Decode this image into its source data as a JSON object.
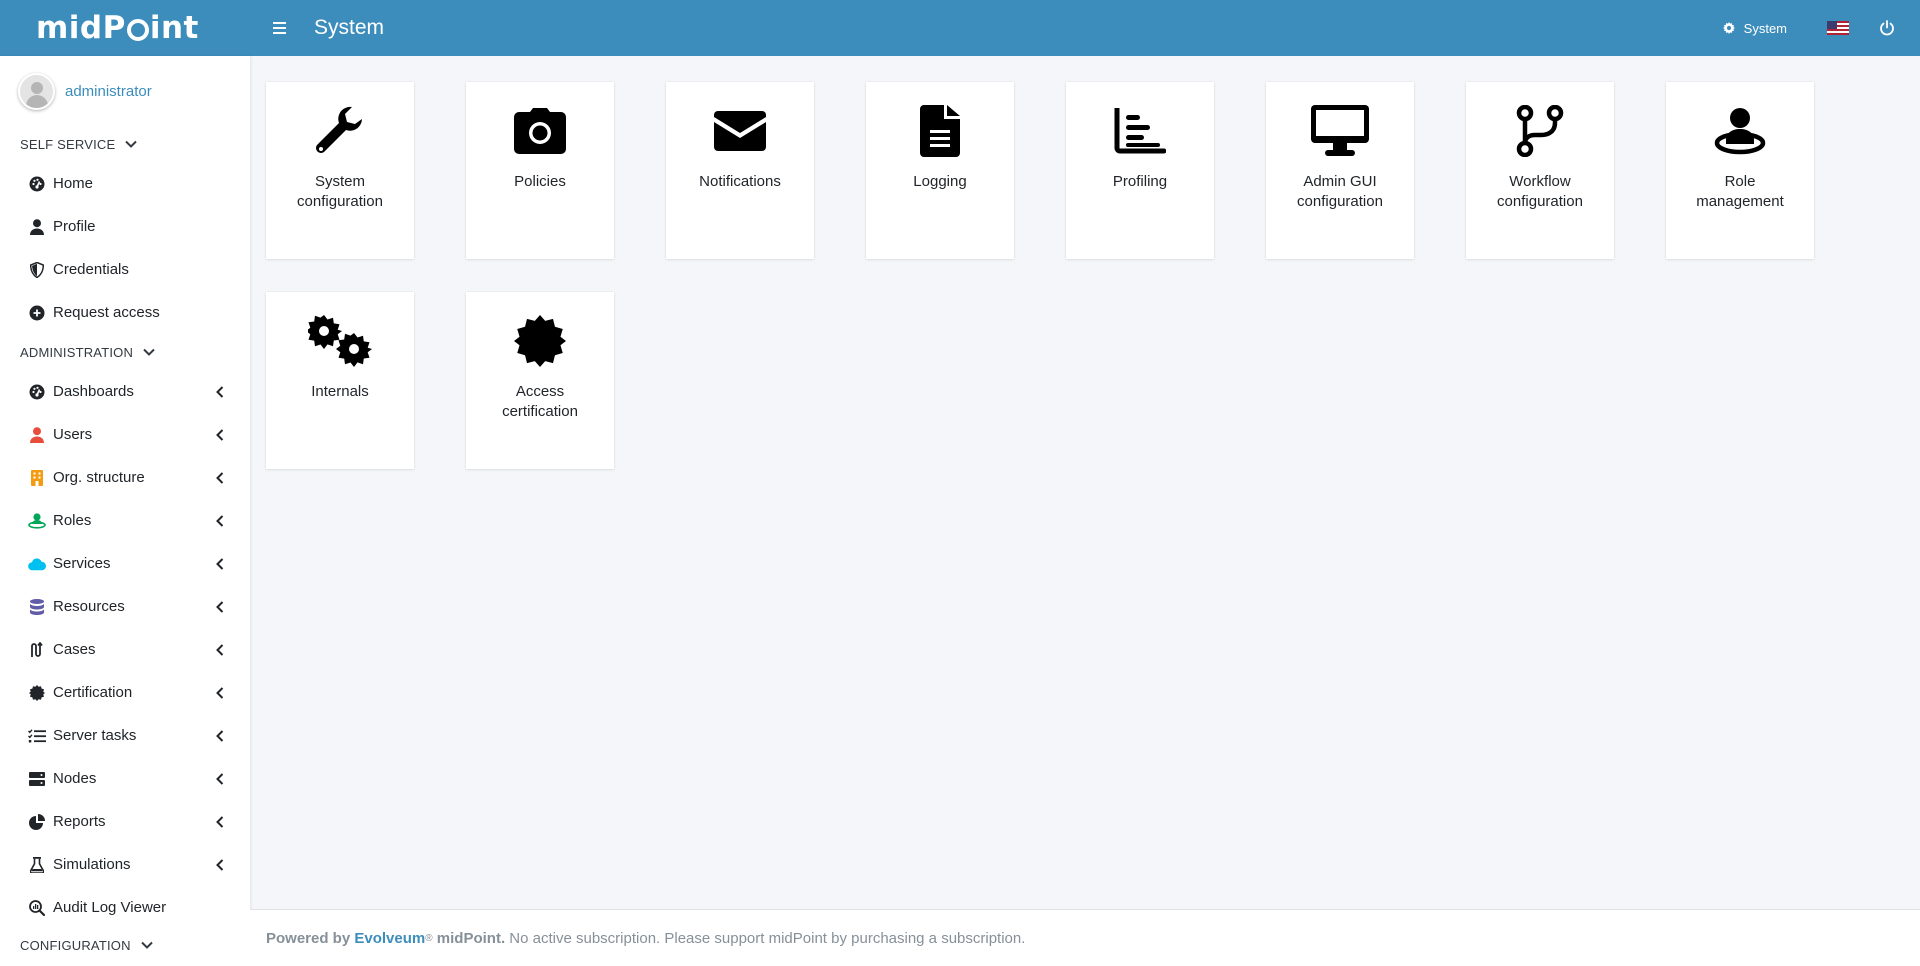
{
  "header": {
    "brand": "midPoint",
    "page_title": "System",
    "system_label": "System"
  },
  "user": {
    "name": "administrator"
  },
  "sidebar": {
    "sections": [
      {
        "title": "SELF SERVICE",
        "items": [
          {
            "label": "Home",
            "icon": "dashboard-icon",
            "has_submenu": false
          },
          {
            "label": "Profile",
            "icon": "user-icon",
            "has_submenu": false
          },
          {
            "label": "Credentials",
            "icon": "shield-icon",
            "has_submenu": false
          },
          {
            "label": "Request access",
            "icon": "plus-circle-icon",
            "has_submenu": false
          }
        ]
      },
      {
        "title": "ADMINISTRATION",
        "items": [
          {
            "label": "Dashboards",
            "icon": "dashboard-icon",
            "has_submenu": true
          },
          {
            "label": "Users",
            "icon": "user-icon",
            "has_submenu": true,
            "color": "#e74c3c"
          },
          {
            "label": "Org. structure",
            "icon": "building-icon",
            "has_submenu": true,
            "color": "#f39c12"
          },
          {
            "label": "Roles",
            "icon": "role-icon",
            "has_submenu": true,
            "color": "#00a65a"
          },
          {
            "label": "Services",
            "icon": "cloud-icon",
            "has_submenu": true,
            "color": "#00c0ef"
          },
          {
            "label": "Resources",
            "icon": "database-icon",
            "has_submenu": true,
            "color": "#605ca8"
          },
          {
            "label": "Cases",
            "icon": "route-icon",
            "has_submenu": true
          },
          {
            "label": "Certification",
            "icon": "certificate-icon",
            "has_submenu": true
          },
          {
            "label": "Server tasks",
            "icon": "tasks-icon",
            "has_submenu": true
          },
          {
            "label": "Nodes",
            "icon": "server-icon",
            "has_submenu": true
          },
          {
            "label": "Reports",
            "icon": "pie-chart-icon",
            "has_submenu": true
          },
          {
            "label": "Simulations",
            "icon": "flask-icon",
            "has_submenu": true
          },
          {
            "label": "Audit Log Viewer",
            "icon": "search-chart-icon",
            "has_submenu": false
          }
        ]
      },
      {
        "title": "CONFIGURATION",
        "items": []
      }
    ]
  },
  "tiles": [
    {
      "label": "System configuration",
      "icon": "wrench-icon"
    },
    {
      "label": "Policies",
      "icon": "camera-icon"
    },
    {
      "label": "Notifications",
      "icon": "envelope-icon"
    },
    {
      "label": "Logging",
      "icon": "file-text-icon"
    },
    {
      "label": "Profiling",
      "icon": "bar-chart-icon"
    },
    {
      "label": "Admin GUI configuration",
      "icon": "desktop-icon"
    },
    {
      "label": "Workflow configuration",
      "icon": "code-branch-icon"
    },
    {
      "label": "Role management",
      "icon": "user-role-icon"
    },
    {
      "label": "Internals",
      "icon": "cogs-icon"
    },
    {
      "label": "Access certification",
      "icon": "certificate-icon"
    }
  ],
  "footer": {
    "powered_by": "Powered by",
    "company": "Evolveum",
    "registered": "®",
    "product": "midPoint.",
    "message": "No active subscription. Please support midPoint by purchasing a subscription."
  },
  "colors": {
    "navbar": "#3c8dbc",
    "link": "#3c8dbc",
    "background": "#f4f6f9"
  }
}
